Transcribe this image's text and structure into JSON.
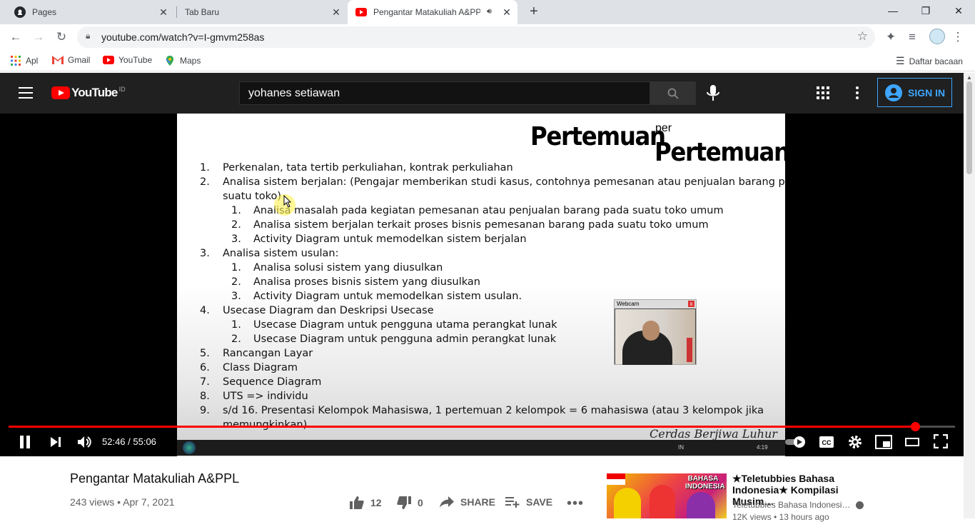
{
  "browser": {
    "tabs": [
      {
        "title": "Pages",
        "icon": "github-icon"
      },
      {
        "title": "Tab Baru",
        "icon": ""
      },
      {
        "title": "Pengantar Matakuliah A&PPL",
        "icon": "youtube-icon",
        "audio": "speaker-icon"
      }
    ],
    "new_tab": "+",
    "window": {
      "minimize": "—",
      "restore": "❐",
      "close": "✕"
    },
    "url": "youtube.com/watch?v=I-gmvm258as",
    "bookmarks": [
      {
        "label": "Apl",
        "icon": "apps-grid-icon"
      },
      {
        "label": "Gmail",
        "icon": "gmail-icon"
      },
      {
        "label": "YouTube",
        "icon": "youtube-icon"
      },
      {
        "label": "Maps",
        "icon": "maps-icon"
      }
    ],
    "reading_list": "Daftar bacaan"
  },
  "youtube": {
    "logo_text": "YouTube",
    "country_code": "ID",
    "search_value": "yohanes setiawan",
    "sign_in": "SIGN IN",
    "accent": "#ff0000",
    "link_blue": "#3ea6ff"
  },
  "slide": {
    "title_a": "Pertemuan",
    "title_per": "per",
    "title_b": "Pertemuan",
    "items": [
      {
        "n": "1.",
        "text": "Perkenalan, tata tertib perkuliahan, kontrak perkuliahan"
      },
      {
        "n": "2.",
        "text": "Analisa sistem berjalan: (Pengajar memberikan studi kasus, contohnya pemesanan atau penjualan barang pada",
        "cont": "suatu toko)"
      },
      {
        "n": "1.",
        "text": "Analisa masalah pada kegiatan pemesanan atau penjualan barang pada suatu toko umum",
        "sub": true
      },
      {
        "n": "2.",
        "text": "Analisa sistem berjalan terkait proses bisnis pemesanan barang pada suatu toko umum",
        "sub": true
      },
      {
        "n": "3.",
        "text": "Activity Diagram untuk memodelkan sistem berjalan",
        "sub": true
      },
      {
        "n": "3.",
        "text": "Analisa sistem usulan:"
      },
      {
        "n": "1.",
        "text": "Analisa solusi sistem yang diusulkan",
        "sub": true
      },
      {
        "n": "2.",
        "text": "Analisa proses bisnis sistem yang diusulkan",
        "sub": true
      },
      {
        "n": "3.",
        "text": "Activity Diagram untuk memodelkan sistem usulan.",
        "sub": true
      },
      {
        "n": "4.",
        "text": "Usecase Diagram dan Deskripsi Usecase"
      },
      {
        "n": "1.",
        "text": "Usecase Diagram untuk pengguna utama perangkat lunak",
        "sub": true
      },
      {
        "n": "2.",
        "text": "Usecase Diagram untuk pengguna admin perangkat lunak",
        "sub": true
      },
      {
        "n": "5.",
        "text": "Rancangan Layar"
      },
      {
        "n": "6.",
        "text": "Class Diagram"
      },
      {
        "n": "7.",
        "text": "Sequence Diagram"
      },
      {
        "n": "8.",
        "text": "UTS => individu"
      },
      {
        "n": "9.",
        "text": "s/d 16. Presentasi Kelompok Mahasiswa, 1 pertemuan 2 kelompok = 6 mahasiswa (atau 3 kelompok jika",
        "cont": "memungkinkan)"
      }
    ],
    "webcam_title": "Webcam",
    "signature": "Cerdas Berjiwa Luhur",
    "taskbar_clock": "4:19",
    "taskbar_lang": "IN"
  },
  "player": {
    "time_display": "52:46 / 55:06",
    "progress_fraction": 0.9577
  },
  "video": {
    "title": "Pengantar Matakuliah A&PPL",
    "meta": "243 views • Apr 7, 2021",
    "likes": "12",
    "dislikes": "0",
    "share": "SHARE",
    "save": "SAVE",
    "more": "•••"
  },
  "recommendation": {
    "thumb_label": "BAHASA INDONESIA",
    "title": "★Teletubbies Bahasa Indonesia★ Kompilasi Musim…",
    "channel": "Teletubbies Bahasa Indonesi…",
    "views": "12K views • 13 hours ago"
  }
}
